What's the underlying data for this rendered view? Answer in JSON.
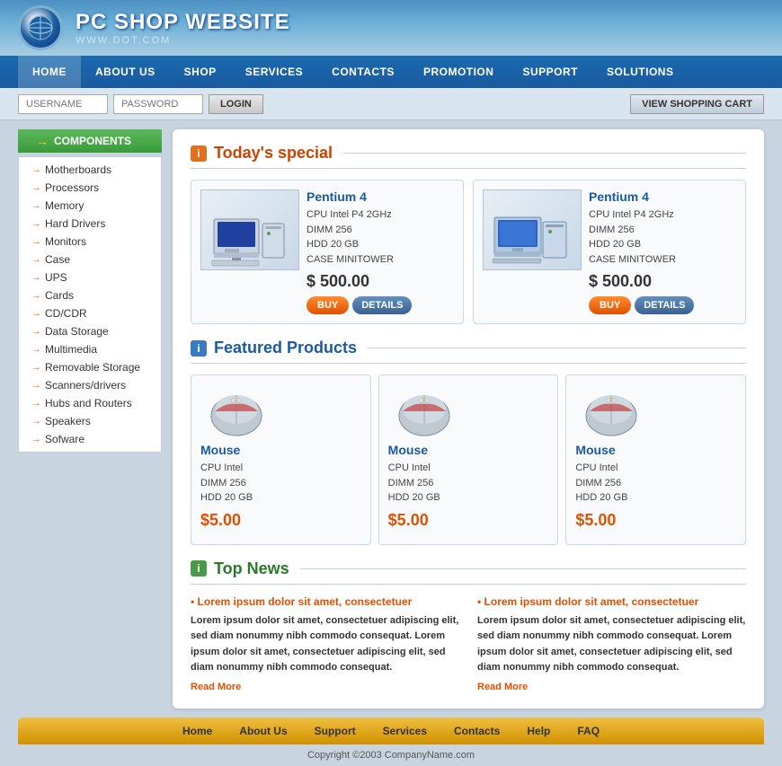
{
  "site": {
    "title": "PC SHOP WEBSITE",
    "subtitle": "WWW.DOT.COM"
  },
  "nav": {
    "items": [
      "HOME",
      "ABOUT US",
      "SHOP",
      "SERVICES",
      "CONTACTS",
      "PROMOTION",
      "SUPPORT",
      "SOLUTIONS"
    ]
  },
  "loginbar": {
    "username_placeholder": "USERNAME",
    "password_placeholder": "PASSWORD",
    "login_label": "LOGIN",
    "cart_label": "VIEW SHOPPING CART"
  },
  "sidebar": {
    "header": "COMPONENTS",
    "items": [
      "Motherboards",
      "Processors",
      "Memory",
      "Hard Drivers",
      "Monitors",
      "Case",
      "UPS",
      "Cards",
      "CD/CDR",
      "Data Storage",
      "Multimedia",
      "Removable Storage",
      "Scanners/drivers",
      "Hubs and Routers",
      "Speakers",
      "Sofware"
    ]
  },
  "todays_special": {
    "section_title": "Today's special",
    "products": [
      {
        "name": "Pentium 4",
        "specs": "CPU Intel P4 2GHz\nDIMM 256\nHDD 20 GB\nCASE MINITOWER",
        "price": "$ 500.00",
        "buy_label": "BUY",
        "details_label": "DETAILS"
      },
      {
        "name": "Pentium 4",
        "specs": "CPU Intel P4 2GHz\nDIMM 256\nHDD 20 GB\nCASE MINITOWER",
        "price": "$ 500.00",
        "buy_label": "BUY",
        "details_label": "DETAILS"
      }
    ]
  },
  "featured_products": {
    "section_title": "Featured Products",
    "products": [
      {
        "name": "Mouse",
        "specs": "CPU Intel\nDIMM 256\nHDD 20 GB",
        "price": "$5.00"
      },
      {
        "name": "Mouse",
        "specs": "CPU Intel\nDIMM 256\nHDD 20 GB",
        "price": "$5.00"
      },
      {
        "name": "Mouse",
        "specs": "CPU Intel\nDIMM 256\nHDD 20 GB",
        "price": "$5.00"
      }
    ]
  },
  "top_news": {
    "section_title": "Top News",
    "articles": [
      {
        "headline": "Lorem ipsum dolor sit amet, consectetuer",
        "body": "Lorem ipsum dolor sit amet, consectetuer adipiscing elit, sed diam nonummy nibh commodo consequat. Lorem ipsum dolor sit amet, consectetuer adipiscing elit, sed diam nonummy nibh commodo consequat.",
        "read_more": "Read More"
      },
      {
        "headline": "Lorem ipsum dolor sit amet, consectetuer",
        "body": "Lorem ipsum dolor sit amet, consectetuer adipiscing elit, sed diam nonummy nibh commodo consequat. Lorem ipsum dolor sit amet, consectetuer adipiscing elit, sed diam nonummy nibh commodo consequat.",
        "read_more": "Read More"
      }
    ]
  },
  "footer": {
    "links": [
      "Home",
      "About Us",
      "Support",
      "Services",
      "Contacts",
      "Help",
      "FAQ"
    ],
    "copyright": "Copyright ©2003 CompanyName.com"
  }
}
